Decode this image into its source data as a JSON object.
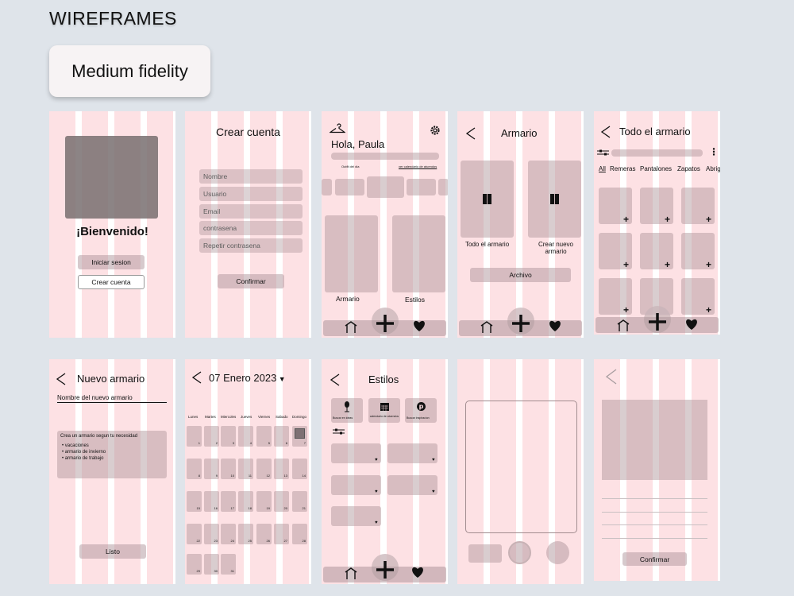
{
  "header": {
    "title": "WIREFRAMES",
    "badge": "Medium fidelity"
  },
  "welcome": {
    "heading": "¡Bienvenido!",
    "login": "Iniciar sesion",
    "register": "Crear cuenta"
  },
  "signup": {
    "title": "Crear cuenta",
    "fields": [
      "Nombre",
      "Usuario",
      "Email",
      "contrasena",
      "Repetir contrasena"
    ],
    "confirm": "Confirmar"
  },
  "home": {
    "greeting": "Hola, Paula",
    "outfit_link": "Outfit del dia",
    "calendar_link": "ver calendario de atuendos",
    "wardrobe": "Armario",
    "styles": "Estilos"
  },
  "armario": {
    "title": "Armario",
    "all": "Todo el armario",
    "new": "Crear nuevo armario",
    "archive": "Archivo"
  },
  "todo": {
    "title": "Todo el armario",
    "tabs": [
      "All",
      "Remeras",
      "Pantalones",
      "Zapatos",
      "Abrig"
    ]
  },
  "nuevo": {
    "title": "Nuevo armario",
    "name_field": "Nombre del nuevo armario",
    "hint": "Crea un armario segun tu necesidad",
    "examples": [
      "vacaciones",
      "armario de invierno",
      "armario de trabajo"
    ],
    "done": "Listo"
  },
  "calendar": {
    "date": "07 Enero 2023",
    "weekdays": [
      "Lunes",
      "Martes",
      "Miercoles",
      "Jueves",
      "Viernes",
      "Sabado",
      "Domingo"
    ],
    "days": [
      "1",
      "2",
      "3",
      "4",
      "5",
      "6",
      "7",
      "8",
      "9",
      "10",
      "11",
      "12",
      "13",
      "14",
      "15",
      "16",
      "17",
      "18",
      "19",
      "20",
      "21",
      "22",
      "23",
      "24",
      "25",
      "26",
      "27",
      "28",
      "29",
      "30",
      "31"
    ]
  },
  "estilos": {
    "title": "Estilos",
    "actions": [
      "Buscar en ideas",
      "calendario de atuendos",
      "Buscar inspiracion"
    ]
  },
  "confirm_screen": {
    "confirm": "Confirmar"
  }
}
